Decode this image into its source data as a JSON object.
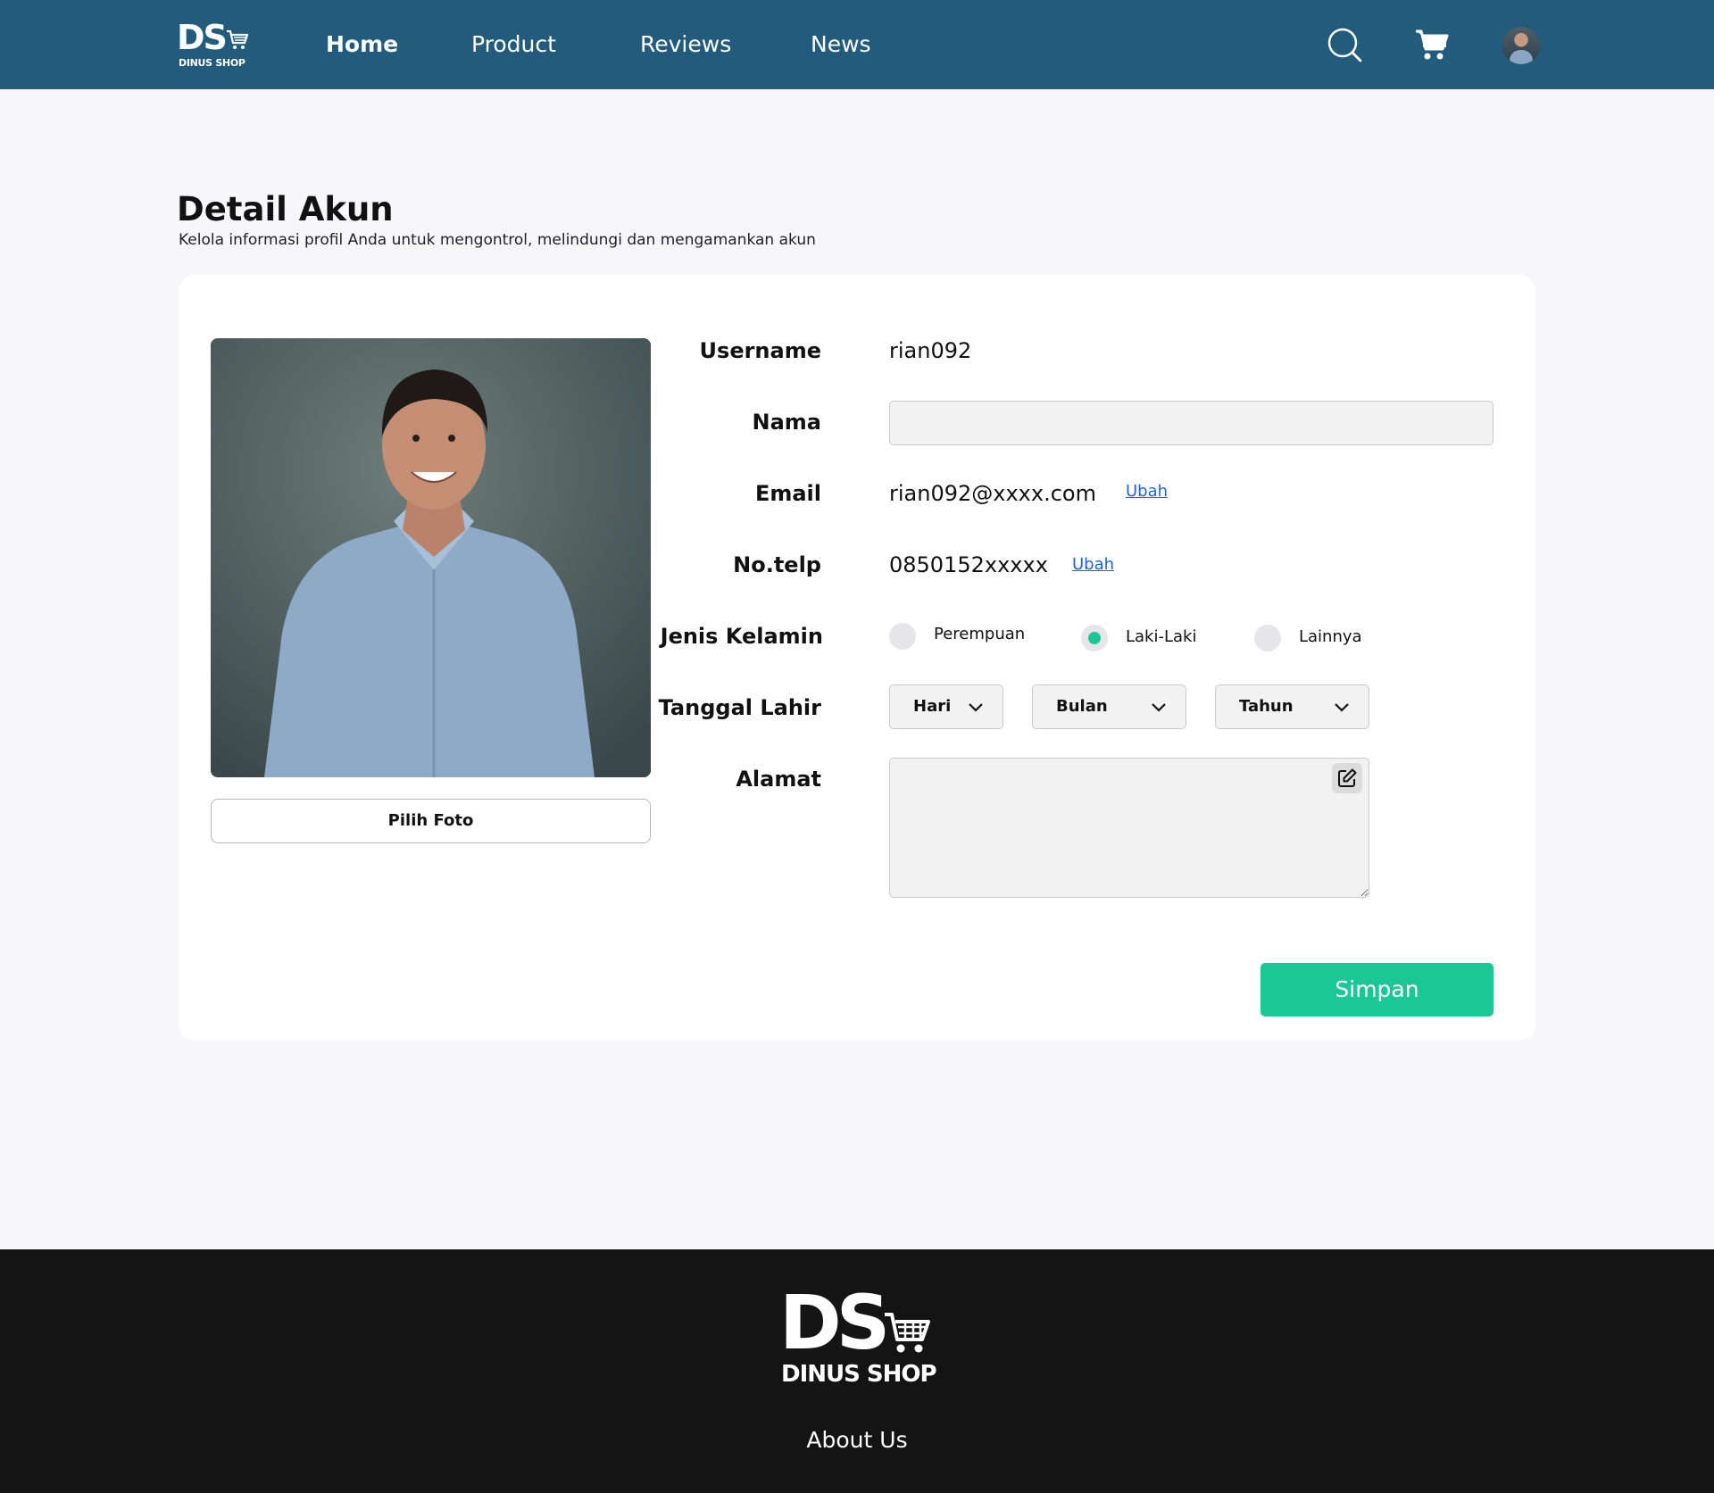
{
  "header": {
    "logo_text": "DS",
    "logo_sub": "DINUS SHOP",
    "nav": [
      {
        "label": "Home",
        "active": true
      },
      {
        "label": "Product",
        "active": false
      },
      {
        "label": "Reviews",
        "active": false
      },
      {
        "label": "News",
        "active": false
      }
    ],
    "icons": [
      "search-icon",
      "cart-icon",
      "avatar"
    ]
  },
  "page": {
    "title": "Detail Akun",
    "subtitle": "Kelola informasi profil Anda untuk mengontrol, melindungi dan mengamankan akun"
  },
  "profile": {
    "choose_photo_label": "Pilih Foto",
    "fields": {
      "username_label": "Username",
      "username_value": "rian092",
      "nama_label": "Nama",
      "nama_value": "",
      "email_label": "Email",
      "email_value": "rian092@xxxx.com",
      "email_change": "Ubah",
      "phone_label": "No.telp",
      "phone_value": "0850152xxxxx",
      "phone_change": "Ubah",
      "gender_label": "Jenis Kelamin",
      "gender_options": [
        "Perempuan",
        "Laki-Laki",
        "Lainnya"
      ],
      "gender_selected": "Laki-Laki",
      "birth_label": "Tanggal Lahir",
      "birth_day": "Hari",
      "birth_month": "Bulan",
      "birth_year": "Tahun",
      "address_label": "Alamat",
      "address_value": ""
    },
    "save_label": "Simpan"
  },
  "colors": {
    "header_bg": "#235b7c",
    "accent": "#1cc796",
    "link": "#1e64d8",
    "footer_bg": "#141414"
  },
  "footer": {
    "logo_text": "DS",
    "logo_sub": "DINUS SHOP",
    "about_label": "About Us"
  }
}
